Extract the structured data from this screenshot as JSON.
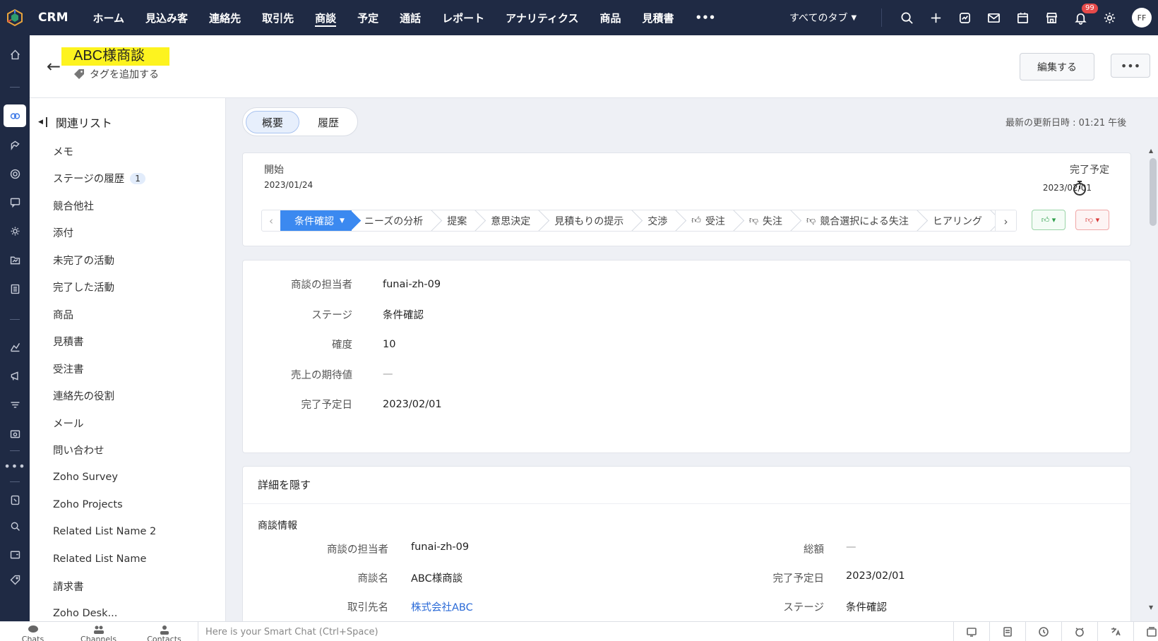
{
  "topnav": {
    "brand": "CRM",
    "links": [
      "ホーム",
      "見込み客",
      "連絡先",
      "取引先",
      "商談",
      "予定",
      "通話",
      "レポート",
      "アナリティクス",
      "商品",
      "見積書"
    ],
    "active_link": "商談",
    "more": "•••",
    "all_tabs": "すべてのタブ",
    "notification_count": "99",
    "avatar_initials": "FF",
    "icons": [
      "search-icon",
      "plus-icon",
      "activity-icon",
      "mail-icon",
      "calendar-icon",
      "marketplace-icon",
      "bell-icon",
      "gear-icon"
    ]
  },
  "leftrail": {
    "icons": [
      "home-icon",
      "deals-icon",
      "leads-icon",
      "contacts-icon",
      "chat-icon",
      "settings-cog-icon",
      "folder-icon",
      "document-icon",
      "analytics-icon",
      "campaign-icon",
      "filter-icon",
      "quote-icon",
      "more-icon",
      "note-icon",
      "search-zoom-icon",
      "wallet-icon",
      "tag-icon"
    ],
    "more_label": "•••"
  },
  "header": {
    "title": "ABC様商談",
    "add_tag": "タグを追加する",
    "edit_button": "編集する",
    "more_button": "•••",
    "highlight_color": "#fdf31f"
  },
  "related": {
    "heading": "関連リスト",
    "items": [
      {
        "label": "メモ",
        "count": ""
      },
      {
        "label": "ステージの履歴",
        "count": "1"
      },
      {
        "label": "競合他社",
        "count": ""
      },
      {
        "label": "添付",
        "count": ""
      },
      {
        "label": "未完了の活動",
        "count": ""
      },
      {
        "label": "完了した活動",
        "count": ""
      },
      {
        "label": "商品",
        "count": ""
      },
      {
        "label": "見積書",
        "count": ""
      },
      {
        "label": "受注書",
        "count": ""
      },
      {
        "label": "連絡先の役割",
        "count": ""
      },
      {
        "label": "メール",
        "count": ""
      },
      {
        "label": "問い合わせ",
        "count": ""
      },
      {
        "label": "Zoho Survey",
        "count": ""
      },
      {
        "label": "Zoho Projects",
        "count": ""
      },
      {
        "label": "Related List Name 2",
        "count": ""
      },
      {
        "label": "Related List Name",
        "count": ""
      },
      {
        "label": "請求書",
        "count": ""
      },
      {
        "label": "Zoho Desk...",
        "count": ""
      }
    ]
  },
  "tabs": {
    "overview": "概要",
    "history": "履歴"
  },
  "last_updated": "最新の更新日時 : 01:21 午後",
  "stage": {
    "start_label": "開始",
    "start_date": "2023/01/24",
    "end_label": "完了予定",
    "end_date": "2023/02/01",
    "stages": [
      {
        "label": "条件確認",
        "active": true,
        "thumb": ""
      },
      {
        "label": "ニーズの分析",
        "active": false,
        "thumb": ""
      },
      {
        "label": "提案",
        "active": false,
        "thumb": ""
      },
      {
        "label": "意思決定",
        "active": false,
        "thumb": ""
      },
      {
        "label": "見積もりの提示",
        "active": false,
        "thumb": ""
      },
      {
        "label": "交渉",
        "active": false,
        "thumb": ""
      },
      {
        "label": "受注",
        "active": false,
        "thumb": "up"
      },
      {
        "label": "失注",
        "active": false,
        "thumb": "down"
      },
      {
        "label": "競合選択による失注",
        "active": false,
        "thumb": "down"
      },
      {
        "label": "ヒアリング",
        "active": false,
        "thumb": ""
      }
    ],
    "active_color": "#3b89f0"
  },
  "key_fields": [
    {
      "key": "商談の担当者",
      "value": "funai-zh-09"
    },
    {
      "key": "ステージ",
      "value": "条件確認"
    },
    {
      "key": "確度",
      "value": "10"
    },
    {
      "key": "売上の期待値",
      "value": "—"
    },
    {
      "key": "完了予定日",
      "value": "2023/02/01"
    }
  ],
  "details": {
    "hide_label": "詳細を隠す",
    "section": "商談情報",
    "left": [
      {
        "key": "商談の担当者",
        "value": "funai-zh-09",
        "link": false
      },
      {
        "key": "商談名",
        "value": "ABC様商談",
        "link": false
      },
      {
        "key": "取引先名",
        "value": "株式会社ABC",
        "link": true
      }
    ],
    "right": [
      {
        "key": "総額",
        "value": "—",
        "link": false
      },
      {
        "key": "完了予定日",
        "value": "2023/02/01",
        "link": false
      },
      {
        "key": "ステージ",
        "value": "条件確認",
        "link": false
      }
    ]
  },
  "bottombar": {
    "chats": "Chats",
    "channels": "Channels",
    "contacts": "Contacts",
    "smart_chat_placeholder": "Here is your Smart Chat (Ctrl+Space)"
  }
}
